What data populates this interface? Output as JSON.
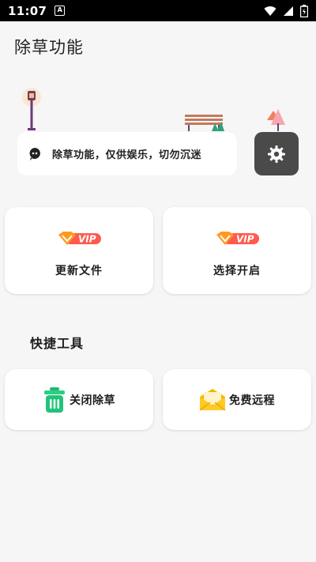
{
  "status_bar": {
    "time": "11:07",
    "app_icon": "A"
  },
  "app": {
    "title": "除草功能"
  },
  "notice": {
    "text": "除草功能，仅供娱乐，切勿沉迷",
    "icon": "quote-bubble-icon"
  },
  "settings": {
    "icon": "gear-icon"
  },
  "cards": [
    {
      "label": "更新文件",
      "badge": "VIP"
    },
    {
      "label": "选择开启",
      "badge": "VIP"
    }
  ],
  "quick_tools": {
    "title": "快捷工具",
    "items": [
      {
        "label": "关闭除草",
        "icon": "trash-bin-icon"
      },
      {
        "label": "免费远程",
        "icon": "envelope-icon"
      }
    ]
  },
  "colors": {
    "vip_orange": "#ff7a1a",
    "vip_pink": "#ff4d5c",
    "green": "#22c47a",
    "settings_bg": "#4a4a4a"
  }
}
